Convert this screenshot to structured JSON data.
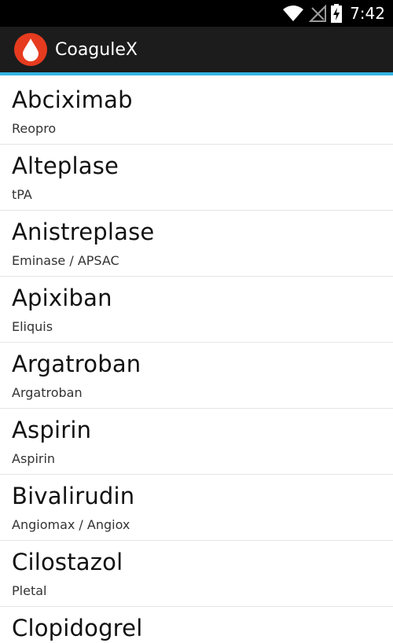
{
  "status_bar": {
    "time": "7:42",
    "icons": [
      "wifi-icon",
      "signal-icon",
      "battery-charging-icon"
    ]
  },
  "action_bar": {
    "app_icon": "blood-drop-icon",
    "title": "CoaguleX",
    "accent_color": "#33b5e5",
    "icon_color": "#e63b1f"
  },
  "drugs": [
    {
      "name": "Abciximab",
      "brand": "Reopro"
    },
    {
      "name": "Alteplase",
      "brand": "tPA"
    },
    {
      "name": "Anistreplase",
      "brand": "Eminase / APSAC"
    },
    {
      "name": "Apixiban",
      "brand": "Eliquis"
    },
    {
      "name": "Argatroban",
      "brand": "Argatroban"
    },
    {
      "name": "Aspirin",
      "brand": "Aspirin"
    },
    {
      "name": "Bivalirudin",
      "brand": "Angiomax / Angiox"
    },
    {
      "name": "Cilostazol",
      "brand": "Pletal"
    },
    {
      "name": "Clopidogrel",
      "brand": ""
    }
  ]
}
